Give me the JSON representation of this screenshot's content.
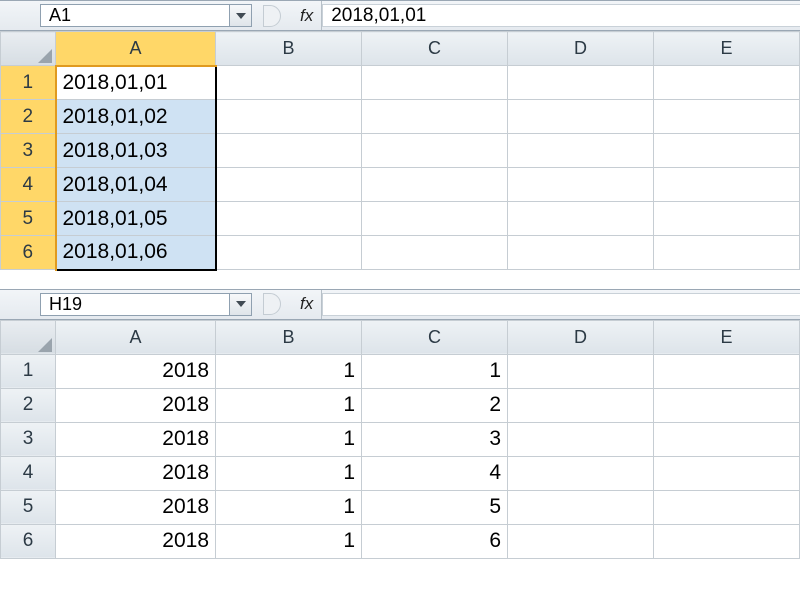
{
  "top": {
    "namebox": "A1",
    "fx_label": "fx",
    "formula": "2018,01,01",
    "columns": [
      "A",
      "B",
      "C",
      "D",
      "E"
    ],
    "rows": [
      {
        "n": "1",
        "a": "2018,01,01"
      },
      {
        "n": "2",
        "a": "2018,01,02"
      },
      {
        "n": "3",
        "a": "2018,01,03"
      },
      {
        "n": "4",
        "a": "2018,01,04"
      },
      {
        "n": "5",
        "a": "2018,01,05"
      },
      {
        "n": "6",
        "a": "2018,01,06"
      }
    ]
  },
  "bottom": {
    "namebox": "H19",
    "fx_label": "fx",
    "formula": "",
    "columns": [
      "A",
      "B",
      "C",
      "D",
      "E"
    ],
    "rows": [
      {
        "n": "1",
        "a": "2018",
        "b": "1",
        "c": "1"
      },
      {
        "n": "2",
        "a": "2018",
        "b": "1",
        "c": "2"
      },
      {
        "n": "3",
        "a": "2018",
        "b": "1",
        "c": "3"
      },
      {
        "n": "4",
        "a": "2018",
        "b": "1",
        "c": "4"
      },
      {
        "n": "5",
        "a": "2018",
        "b": "1",
        "c": "5"
      },
      {
        "n": "6",
        "a": "2018",
        "b": "1",
        "c": "6"
      }
    ]
  },
  "chart_data": [
    {
      "type": "table",
      "title": "Sheet 1 (selected range A1:A6)",
      "columns": [
        "A"
      ],
      "rows": [
        [
          "2018,01,01"
        ],
        [
          "2018,01,02"
        ],
        [
          "2018,01,03"
        ],
        [
          "2018,01,04"
        ],
        [
          "2018,01,05"
        ],
        [
          "2018,01,06"
        ]
      ]
    },
    {
      "type": "table",
      "title": "Sheet 2 (split result)",
      "columns": [
        "A",
        "B",
        "C"
      ],
      "rows": [
        [
          2018,
          1,
          1
        ],
        [
          2018,
          1,
          2
        ],
        [
          2018,
          1,
          3
        ],
        [
          2018,
          1,
          4
        ],
        [
          2018,
          1,
          5
        ],
        [
          2018,
          1,
          6
        ]
      ]
    }
  ]
}
